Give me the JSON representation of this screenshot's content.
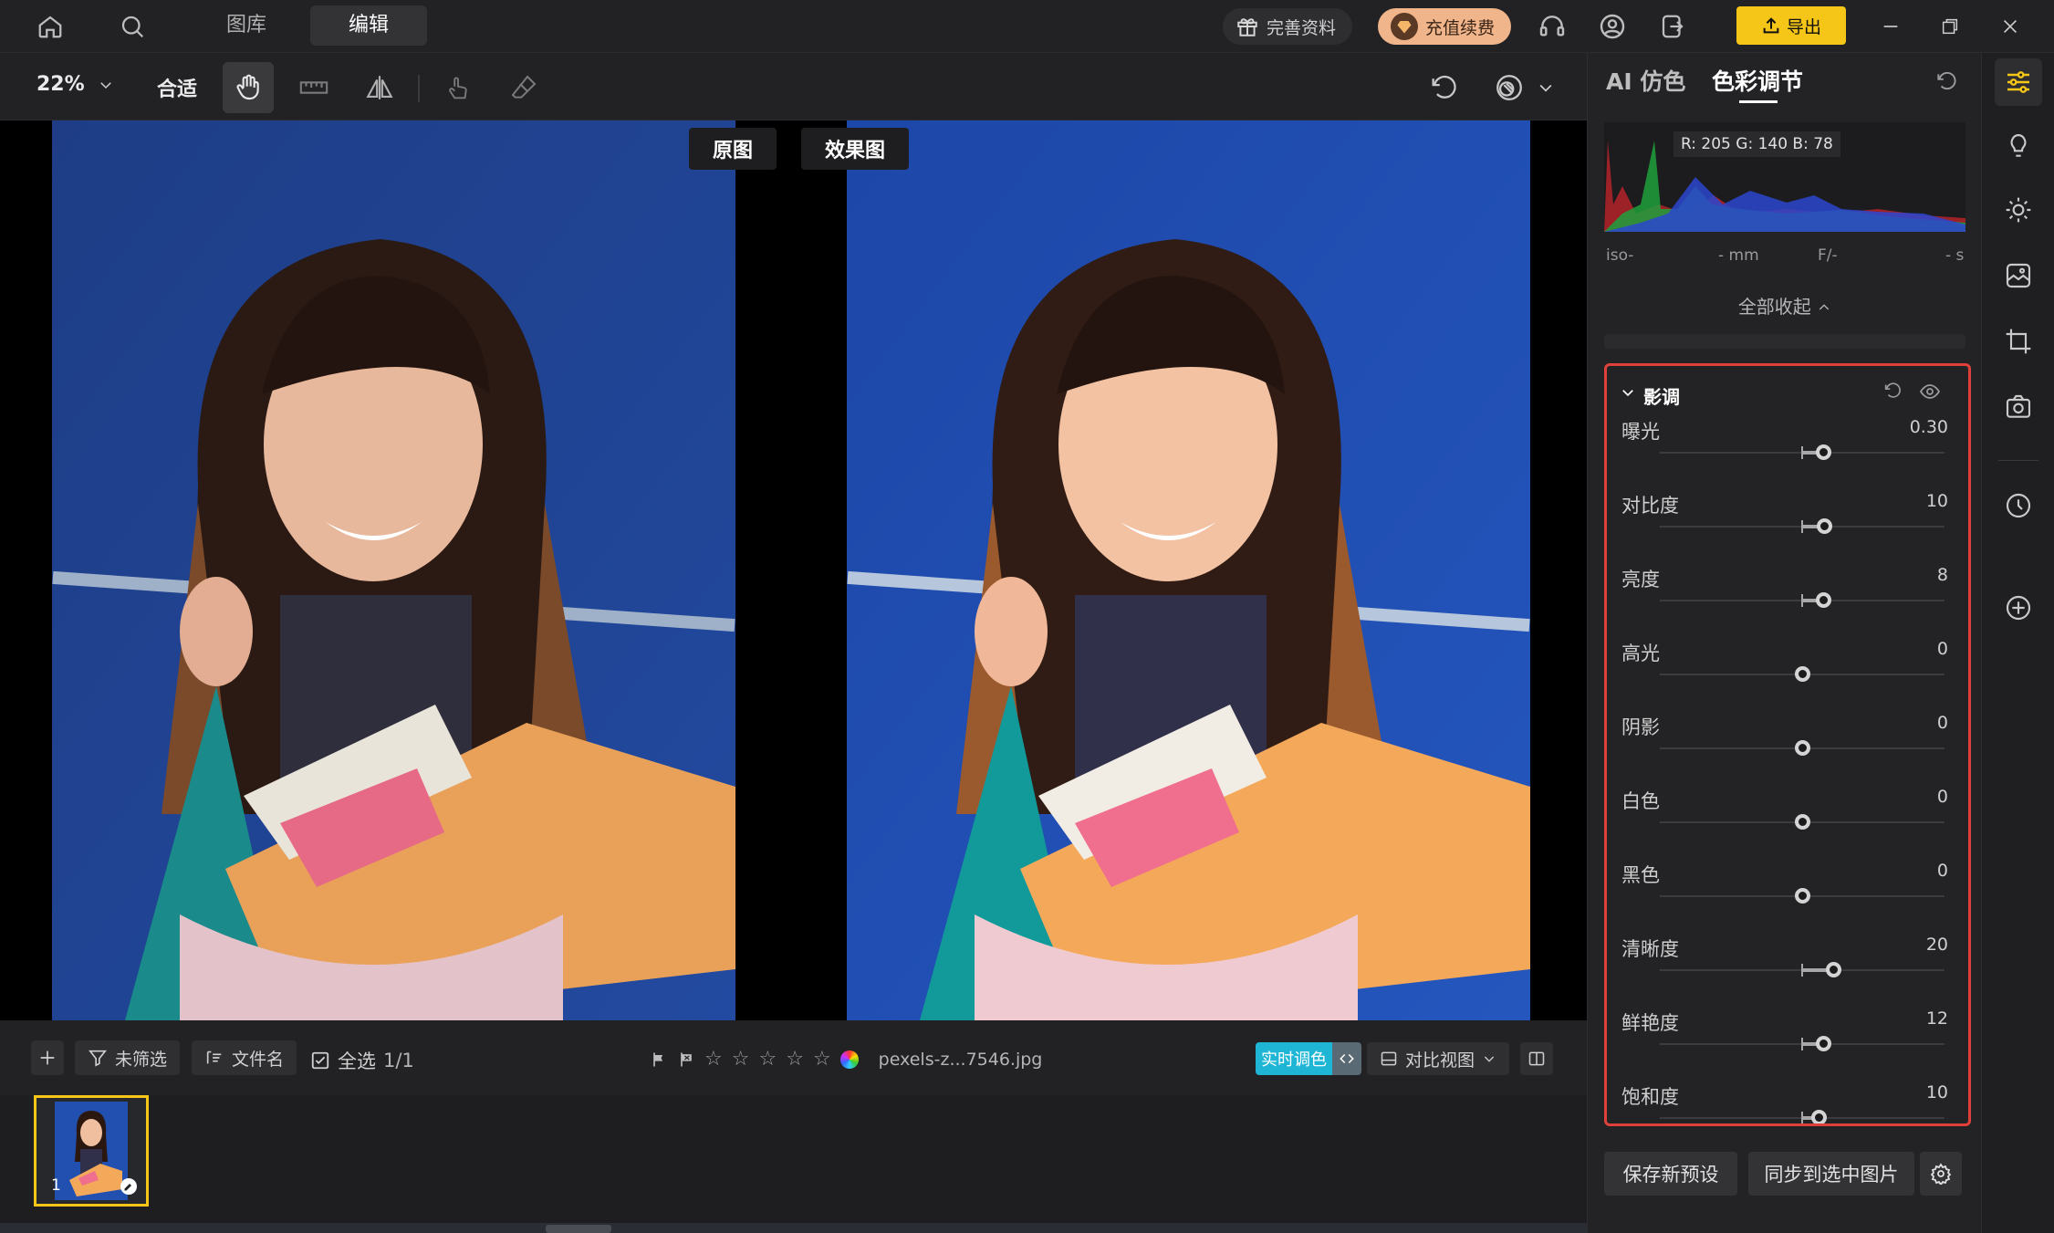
{
  "topbar": {
    "tabs": [
      {
        "label": "图库"
      },
      {
        "label": "编辑"
      }
    ],
    "complete_profile": "完善资料",
    "recharge": "充值续费",
    "export": "导出"
  },
  "toolbar": {
    "zoom": "22%",
    "fit": "合适"
  },
  "canvas": {
    "original_label": "原图",
    "result_label": "效果图"
  },
  "bottombar": {
    "unfiltered": "未筛选",
    "filename_sort": "文件名",
    "select_all": "全选",
    "count": "1/1",
    "filename": "pexels-z...7546.jpg",
    "realtime": "实时调色",
    "compare_view": "对比视图"
  },
  "filmstrip": {
    "index": "1"
  },
  "panel": {
    "tab_ai": "AI 仿色",
    "tab_color": "色彩调节",
    "histogram": {
      "rgb": "R: 205  G: 140  B: 78",
      "iso": "iso-",
      "mm": "- mm",
      "f": "F/-",
      "s": "- s"
    },
    "collapse_all": "全部收起",
    "section_title": "影调",
    "sliders": [
      {
        "label": "曝光",
        "value": "0.30",
        "pos": 0.575
      },
      {
        "label": "对比度",
        "value": "10",
        "pos": 0.58
      },
      {
        "label": "亮度",
        "value": "8",
        "pos": 0.576
      },
      {
        "label": "高光",
        "value": "0",
        "pos": 0.5
      },
      {
        "label": "阴影",
        "value": "0",
        "pos": 0.5
      },
      {
        "label": "白色",
        "value": "0",
        "pos": 0.5
      },
      {
        "label": "黑色",
        "value": "0",
        "pos": 0.5
      },
      {
        "label": "清晰度",
        "value": "20",
        "pos": 0.61
      },
      {
        "label": "鲜艳度",
        "value": "12",
        "pos": 0.575
      },
      {
        "label": "饱和度",
        "value": "10",
        "pos": 0.56
      }
    ],
    "save_preset": "保存新预设",
    "sync": "同步到选中图片"
  },
  "colors": {
    "accent": "#f5c518",
    "highlight_border": "#e0403b",
    "realtime": "#1fb6d6"
  }
}
